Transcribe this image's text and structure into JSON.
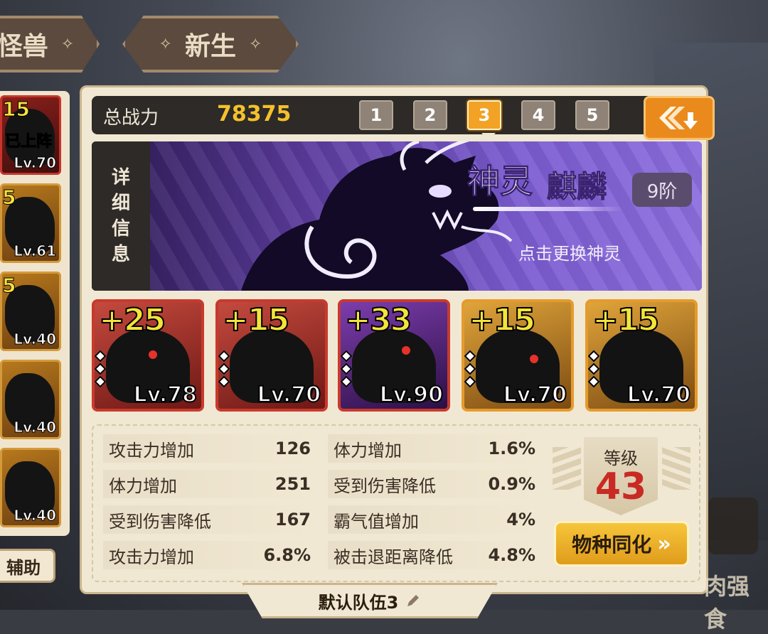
{
  "top_tabs": [
    {
      "label": "怪兽"
    },
    {
      "label": "新生"
    }
  ],
  "roster": {
    "cards": [
      {
        "plus": "15",
        "level": "Lv.70",
        "status": "已上阵",
        "frame": "red"
      },
      {
        "plus": "5",
        "level": "Lv.61",
        "frame": "gold"
      },
      {
        "plus": "5",
        "level": "Lv.40",
        "frame": "gold"
      },
      {
        "plus": "",
        "level": "Lv.40",
        "frame": "gold"
      },
      {
        "plus": "",
        "level": "Lv.40",
        "frame": "gold"
      }
    ],
    "assist_label": "辅助"
  },
  "power": {
    "label": "总战力",
    "value": "78375"
  },
  "teams": {
    "buttons": [
      "1",
      "2",
      "3",
      "4",
      "5"
    ],
    "active": "3"
  },
  "spirit": {
    "detail_label": [
      "详",
      "细",
      "信",
      "息"
    ],
    "category": "神灵",
    "name": "麒麟",
    "rank": "9阶",
    "change_hint": "点击更换神灵"
  },
  "heroes": [
    {
      "plus": "+25",
      "level": "Lv.78",
      "frame": "red"
    },
    {
      "plus": "+15",
      "level": "Lv.70",
      "frame": "red"
    },
    {
      "plus": "+33",
      "level": "Lv.90",
      "frame": "purple"
    },
    {
      "plus": "+15",
      "level": "Lv.70",
      "frame": "gold"
    },
    {
      "plus": "+15",
      "level": "Lv.70",
      "frame": "gold"
    }
  ],
  "stats": [
    {
      "name": "攻击力增加",
      "value": "126"
    },
    {
      "name": "体力增加",
      "value": "251"
    },
    {
      "name": "受到伤害降低",
      "value": "167"
    },
    {
      "name": "攻击力增加",
      "value": "6.8%"
    },
    {
      "name": "体力增加",
      "value": "1.6%"
    },
    {
      "name": "受到伤害降低",
      "value": "0.9%"
    },
    {
      "name": "霸气值增加",
      "value": "4%"
    },
    {
      "name": "被击退距离降低",
      "value": "4.8%"
    }
  ],
  "level": {
    "label": "等级",
    "value": "43"
  },
  "assimilate": {
    "label": "物种同化",
    "arrows": "»"
  },
  "team_name": "默认队伍3",
  "right_edge": {
    "text": "肉强食"
  },
  "colors": {
    "gold": "#f5c02c",
    "accent_orange": "#ea8a1d",
    "level_red": "#c82a24",
    "spirit_purple": "#7b5bd0"
  }
}
